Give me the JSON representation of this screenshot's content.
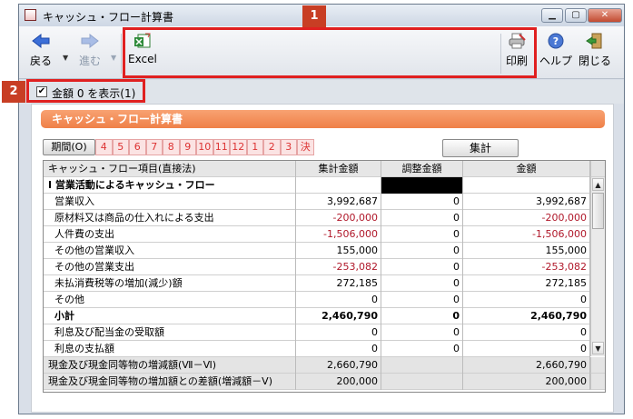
{
  "window": {
    "title": "キャッシュ・フロー計算書",
    "min": "▁",
    "max": "▢",
    "close": "✕"
  },
  "toolbar": {
    "back": "戻る",
    "forward": "進む",
    "excel": "Excel",
    "print": "印刷",
    "help": "ヘルプ",
    "close": "閉じる",
    "dropdown": "▼"
  },
  "badges": {
    "one": "1",
    "two": "2"
  },
  "options": {
    "show_zero": "金額 0 を表示(1)",
    "checked": "✔"
  },
  "panel": {
    "header": "キャッシュ・フロー計算書",
    "total_button": "集計"
  },
  "period": {
    "label": "期間(O)",
    "items": [
      "4",
      "5",
      "6",
      "7",
      "8",
      "9",
      "10",
      "11",
      "12",
      "1",
      "2",
      "3",
      "決"
    ]
  },
  "table": {
    "columns": [
      "キャッシュ・フロー項目(直接法)",
      "集計金額",
      "調整金額",
      "金額"
    ],
    "rows": [
      [
        "Ⅰ 営業活動によるキャッシュ・フロー",
        "",
        "",
        ""
      ],
      [
        "営業収入",
        "3,992,687",
        "0",
        "3,992,687"
      ],
      [
        "原材料又は商品の仕入れによる支出",
        "-200,000",
        "0",
        "-200,000"
      ],
      [
        "人件費の支出",
        "-1,506,000",
        "0",
        "-1,506,000"
      ],
      [
        "その他の営業収入",
        "155,000",
        "0",
        "155,000"
      ],
      [
        "その他の営業支出",
        "-253,082",
        "0",
        "-253,082"
      ],
      [
        "未払消費税等の増加(減少)額",
        "272,185",
        "0",
        "272,185"
      ],
      [
        "その他",
        "0",
        "0",
        "0"
      ],
      [
        "小計",
        "2,460,790",
        "0",
        "2,460,790"
      ],
      [
        "利息及び配当金の受取額",
        "0",
        "0",
        "0"
      ],
      [
        "利息の支払額",
        "0",
        "0",
        "0"
      ]
    ],
    "footer": [
      [
        "現金及び現金同等物の増減額(Ⅶ－Ⅵ)",
        "2,660,790",
        "",
        "2,660,790"
      ],
      [
        "現金及び現金同等物の増加額との差額(増減額－Ⅴ)",
        "200,000",
        "",
        "200,000"
      ]
    ]
  },
  "scroll": {
    "up": "▲",
    "down": "▼"
  },
  "colors": {
    "accent": "#ef8048",
    "negative": "#b0182a",
    "highlight": "#e02020"
  }
}
